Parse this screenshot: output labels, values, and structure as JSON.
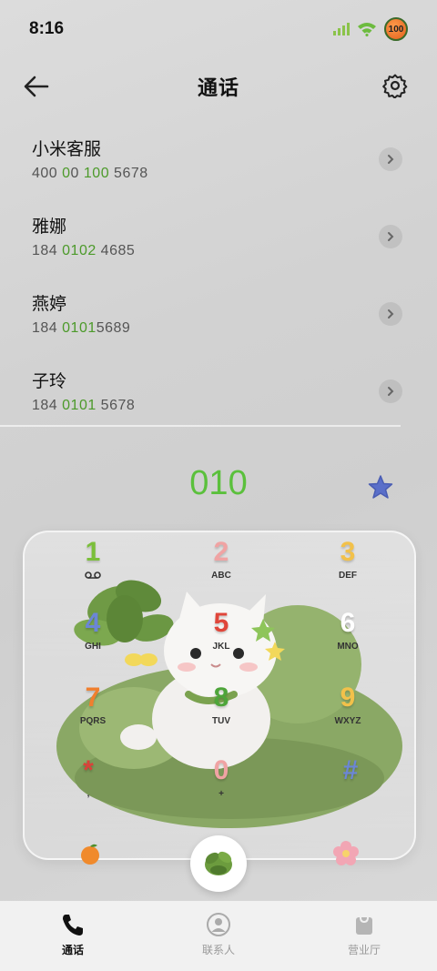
{
  "status_bar": {
    "time": "8:16",
    "battery": "100"
  },
  "header": {
    "title": "通话"
  },
  "contacts": [
    {
      "name": "小米客服",
      "number_parts": [
        "400 ",
        "0",
        "0 ",
        "100",
        " 5678"
      ]
    },
    {
      "name": "雅娜",
      "number_parts": [
        "184 ",
        "0102",
        " 4685"
      ]
    },
    {
      "name": "燕婷",
      "number_parts": [
        "184 ",
        "0101",
        "5689"
      ]
    },
    {
      "name": "子玲",
      "number_parts": [
        "184 ",
        "0101",
        " 5678"
      ]
    }
  ],
  "dialer": {
    "display": "010",
    "keys": [
      {
        "digit": "1",
        "letters": "",
        "color": "#7bbf3a"
      },
      {
        "digit": "2",
        "letters": "ABC",
        "color": "#f0a3a3"
      },
      {
        "digit": "3",
        "letters": "DEF",
        "color": "#f2c14a"
      },
      {
        "digit": "4",
        "letters": "GHI",
        "color": "#6b86d6"
      },
      {
        "digit": "5",
        "letters": "JKL",
        "color": "#e0463a"
      },
      {
        "digit": "6",
        "letters": "MNO",
        "color": "#ffffff"
      },
      {
        "digit": "7",
        "letters": "PQRS",
        "color": "#f07f2e"
      },
      {
        "digit": "8",
        "letters": "TUV",
        "color": "#4ea53a"
      },
      {
        "digit": "9",
        "letters": "WXYZ",
        "color": "#f2c14a"
      },
      {
        "digit": "*",
        "letters": ",",
        "color": "#d9433a"
      },
      {
        "digit": "0",
        "letters": "+",
        "color": "#f0a3a3"
      },
      {
        "digit": "#",
        "letters": "",
        "color": "#6b86d6"
      }
    ]
  },
  "bottom_nav": {
    "tabs": [
      {
        "label": "通话",
        "icon": "phone-icon",
        "active": true
      },
      {
        "label": "联系人",
        "icon": "contacts-icon",
        "active": false
      },
      {
        "label": "营业厅",
        "icon": "shopping-bag-icon",
        "active": false
      }
    ]
  },
  "colors": {
    "accent": "#5bc03c",
    "highlight": "#4c9a2a"
  }
}
